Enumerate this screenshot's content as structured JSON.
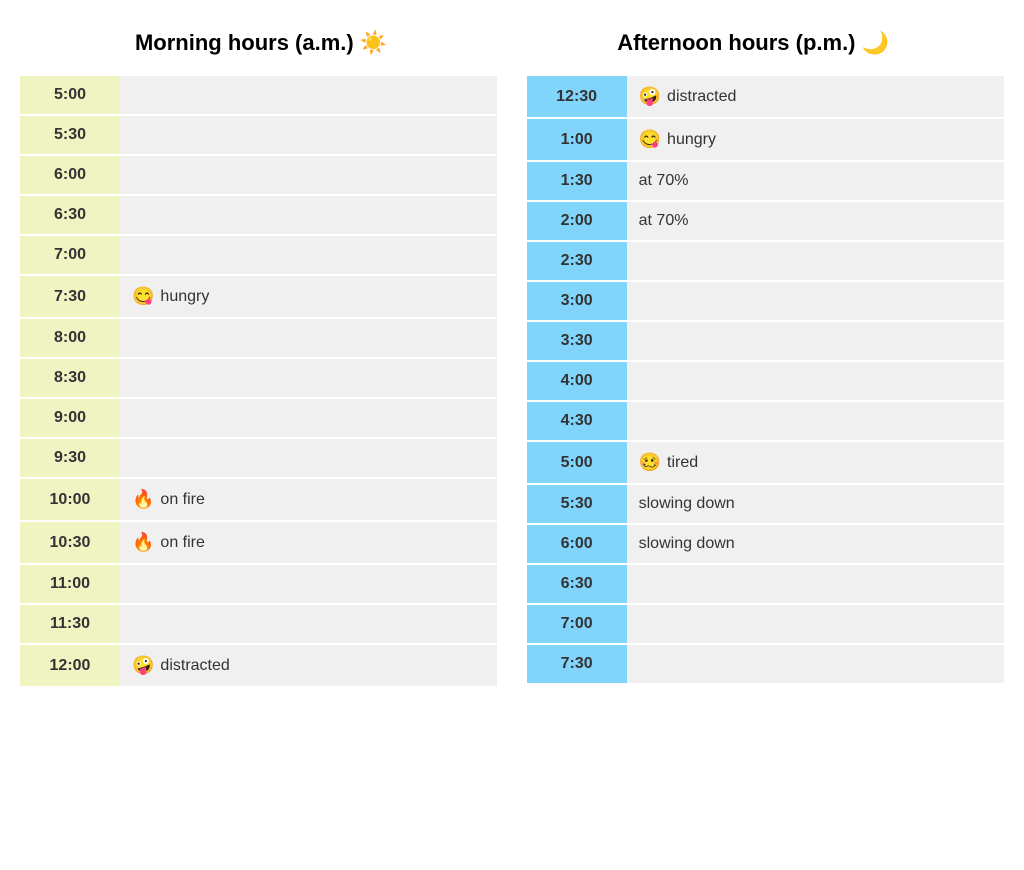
{
  "morning": {
    "header": "Morning hours (a.m.) ☀️",
    "rows": [
      {
        "time": "5:00",
        "note": ""
      },
      {
        "time": "5:30",
        "note": ""
      },
      {
        "time": "6:00",
        "note": ""
      },
      {
        "time": "6:30",
        "note": ""
      },
      {
        "time": "7:00",
        "note": ""
      },
      {
        "time": "7:30",
        "emoji": "😋",
        "note": "hungry"
      },
      {
        "time": "8:00",
        "note": ""
      },
      {
        "time": "8:30",
        "note": ""
      },
      {
        "time": "9:00",
        "note": ""
      },
      {
        "time": "9:30",
        "note": ""
      },
      {
        "time": "10:00",
        "emoji": "🔥",
        "note": "on fire"
      },
      {
        "time": "10:30",
        "emoji": "🔥",
        "note": "on fire"
      },
      {
        "time": "11:00",
        "note": ""
      },
      {
        "time": "11:30",
        "note": ""
      },
      {
        "time": "12:00",
        "emoji": "🤪",
        "note": "distracted"
      }
    ]
  },
  "afternoon": {
    "header": "Afternoon hours (p.m.) 🌙",
    "rows": [
      {
        "time": "12:30",
        "emoji": "🤪",
        "note": "distracted"
      },
      {
        "time": "1:00",
        "emoji": "😋",
        "note": "hungry"
      },
      {
        "time": "1:30",
        "note": "at 70%"
      },
      {
        "time": "2:00",
        "note": "at 70%"
      },
      {
        "time": "2:30",
        "note": ""
      },
      {
        "time": "3:00",
        "note": ""
      },
      {
        "time": "3:30",
        "note": ""
      },
      {
        "time": "4:00",
        "note": ""
      },
      {
        "time": "4:30",
        "note": ""
      },
      {
        "time": "5:00",
        "emoji": "🥴",
        "note": "tired"
      },
      {
        "time": "5:30",
        "note": "slowing down"
      },
      {
        "time": "6:00",
        "note": "slowing down"
      },
      {
        "time": "6:30",
        "note": ""
      },
      {
        "time": "7:00",
        "note": ""
      },
      {
        "time": "7:30",
        "note": ""
      }
    ]
  }
}
